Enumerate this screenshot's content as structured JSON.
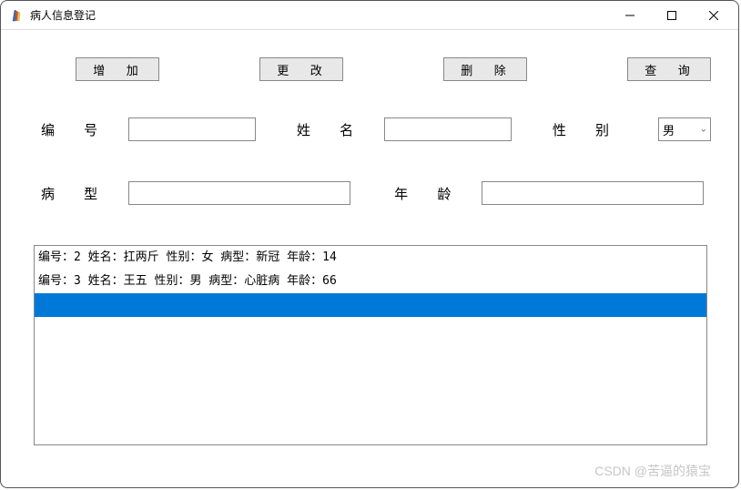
{
  "window": {
    "title": "病人信息登记"
  },
  "buttons": {
    "add": "增 加",
    "edit": "更 改",
    "delete": "删 除",
    "query": "查 询"
  },
  "labels": {
    "id": "编 号",
    "name": "姓 名",
    "gender": "性 别",
    "type": "病 型",
    "age": "年 龄"
  },
  "fields": {
    "id": "",
    "name": "",
    "gender_selected": "男",
    "type": "",
    "age": ""
  },
  "list": {
    "items": [
      "编号：2   姓名：扛两斤 性别：女 病型：新冠 年龄：14",
      "编号：3   姓名：王五 性别：男 病型：心脏病 年龄：66",
      ""
    ],
    "selected_index": 2
  },
  "watermark": "CSDN @苦逼的猿宝"
}
